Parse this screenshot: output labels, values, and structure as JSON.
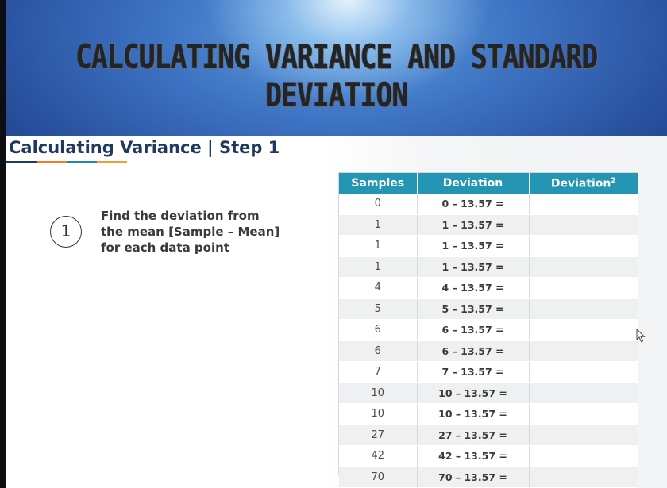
{
  "banner": {
    "title_line1": "CALCULATING VARIANCE AND STANDARD",
    "title_line2": "DEVIATION"
  },
  "section": {
    "title": "Calculating Variance | Step 1",
    "underline_colors": [
      "#1f3a5f",
      "#f07d22",
      "#1e8aa6",
      "#f0a030"
    ]
  },
  "step": {
    "number": "1",
    "instruction_line1": "Find the deviation from",
    "instruction_line2": "the mean [Sample – Mean]",
    "instruction_line3": "for each data point"
  },
  "table": {
    "headers": {
      "samples": "Samples",
      "deviation": "Deviation",
      "deviation_sq": "Deviation",
      "deviation_sq_sup": "2"
    },
    "rows": [
      {
        "sample": "0",
        "deviation": "0 – 13.57 =",
        "deviation_sq": ""
      },
      {
        "sample": "1",
        "deviation": "1 – 13.57 =",
        "deviation_sq": ""
      },
      {
        "sample": "1",
        "deviation": "1 – 13.57 =",
        "deviation_sq": ""
      },
      {
        "sample": "1",
        "deviation": "1 – 13.57 =",
        "deviation_sq": ""
      },
      {
        "sample": "4",
        "deviation": "4 – 13.57 =",
        "deviation_sq": ""
      },
      {
        "sample": "5",
        "deviation": "5 – 13.57 =",
        "deviation_sq": ""
      },
      {
        "sample": "6",
        "deviation": "6 – 13.57 =",
        "deviation_sq": ""
      },
      {
        "sample": "6",
        "deviation": "6 – 13.57 =",
        "deviation_sq": ""
      },
      {
        "sample": "7",
        "deviation": "7 – 13.57 =",
        "deviation_sq": ""
      },
      {
        "sample": "10",
        "deviation": "10 – 13.57 =",
        "deviation_sq": ""
      },
      {
        "sample": "10",
        "deviation": "10 – 13.57 =",
        "deviation_sq": ""
      },
      {
        "sample": "27",
        "deviation": "27 – 13.57 =",
        "deviation_sq": ""
      },
      {
        "sample": "42",
        "deviation": "42 – 13.57 =",
        "deviation_sq": ""
      },
      {
        "sample": "70",
        "deviation": "70 – 13.57 =",
        "deviation_sq": ""
      }
    ],
    "header_color": "#2496b3"
  },
  "cursor": {
    "icon": "mouse-pointer-icon"
  }
}
